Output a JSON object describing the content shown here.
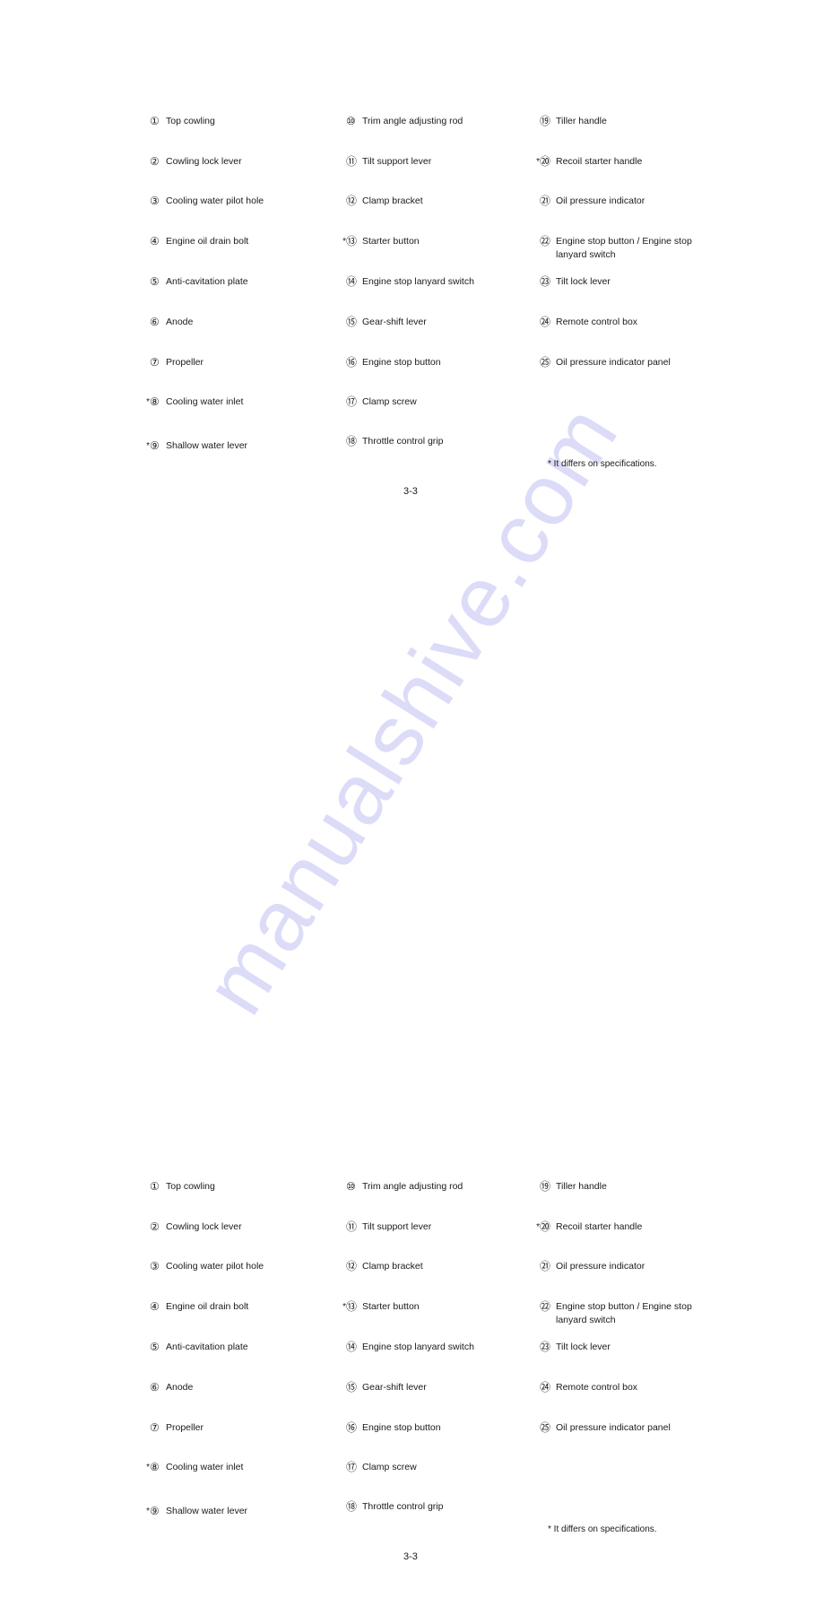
{
  "watermark": "manualshive.com",
  "pages": [
    {
      "columns": [
        [
          {
            "star": "",
            "num": "①",
            "label": "Top cowling"
          },
          {
            "star": "",
            "num": "②",
            "label": "Cowling lock lever"
          },
          {
            "star": "",
            "num": "③",
            "label": "Cooling water pilot hole"
          },
          {
            "star": "",
            "num": "④",
            "label": "Engine oil drain bolt"
          },
          {
            "star": "",
            "num": "⑤",
            "label": "Anti-cavitation plate"
          },
          {
            "star": "",
            "num": "⑥",
            "label": "Anode"
          },
          {
            "star": "",
            "num": "⑦",
            "label": "Propeller"
          },
          {
            "star": "*",
            "num": "⑧",
            "label": "Cooling water inlet"
          },
          {
            "star": "*",
            "num": "⑨",
            "label": "Shallow water lever"
          }
        ],
        [
          {
            "star": "",
            "num": "⑩",
            "label": "Trim angle adjusting rod"
          },
          {
            "star": "",
            "num": "⑪",
            "label": "Tilt support lever"
          },
          {
            "star": "",
            "num": "⑫",
            "label": "Clamp bracket"
          },
          {
            "star": "*",
            "num": "⑬",
            "label": "Starter button"
          },
          {
            "star": "",
            "num": "⑭",
            "label": "Engine stop lanyard switch"
          },
          {
            "star": "",
            "num": "⑮",
            "label": "Gear-shift lever"
          },
          {
            "star": "",
            "num": "⑯",
            "label": "Engine stop button"
          },
          {
            "star": "",
            "num": "⑰",
            "label": "Clamp screw"
          },
          {
            "star": "",
            "num": "⑱",
            "label": "Throttle control grip"
          }
        ],
        [
          {
            "star": "",
            "num": "⑲",
            "label": "Tiller handle"
          },
          {
            "star": "*",
            "num": "⑳",
            "label": "Recoil starter handle"
          },
          {
            "star": "",
            "num": "㉑",
            "label": "Oil pressure indicator"
          },
          {
            "star": "",
            "num": "㉒",
            "label": "Engine stop button / Engine stop",
            "label2": "lanyard switch"
          },
          {
            "star": "",
            "num": "㉓",
            "label": "Tilt lock lever"
          },
          {
            "star": "",
            "num": "㉔",
            "label": "Remote control box"
          },
          {
            "star": "",
            "num": "㉕",
            "label": "Oil pressure indicator panel"
          }
        ]
      ],
      "footnote": "* It differs on specifications.",
      "page_number": "3-3"
    },
    {
      "columns": [
        [
          {
            "star": "",
            "num": "①",
            "label": "Top cowling"
          },
          {
            "star": "",
            "num": "②",
            "label": "Cowling lock lever"
          },
          {
            "star": "",
            "num": "③",
            "label": "Cooling water pilot hole"
          },
          {
            "star": "",
            "num": "④",
            "label": "Engine oil drain bolt"
          },
          {
            "star": "",
            "num": "⑤",
            "label": "Anti-cavitation plate"
          },
          {
            "star": "",
            "num": "⑥",
            "label": "Anode"
          },
          {
            "star": "",
            "num": "⑦",
            "label": "Propeller"
          },
          {
            "star": "*",
            "num": "⑧",
            "label": "Cooling water inlet"
          },
          {
            "star": "*",
            "num": "⑨",
            "label": "Shallow water lever"
          }
        ],
        [
          {
            "star": "",
            "num": "⑩",
            "label": "Trim angle adjusting rod"
          },
          {
            "star": "",
            "num": "⑪",
            "label": "Tilt support lever"
          },
          {
            "star": "",
            "num": "⑫",
            "label": "Clamp bracket"
          },
          {
            "star": "*",
            "num": "⑬",
            "label": "Starter button"
          },
          {
            "star": "",
            "num": "⑭",
            "label": "Engine stop lanyard switch"
          },
          {
            "star": "",
            "num": "⑮",
            "label": "Gear-shift lever"
          },
          {
            "star": "",
            "num": "⑯",
            "label": "Engine stop button"
          },
          {
            "star": "",
            "num": "⑰",
            "label": "Clamp screw"
          },
          {
            "star": "",
            "num": "⑱",
            "label": "Throttle control grip"
          }
        ],
        [
          {
            "star": "",
            "num": "⑲",
            "label": "Tiller handle"
          },
          {
            "star": "*",
            "num": "⑳",
            "label": "Recoil starter handle"
          },
          {
            "star": "",
            "num": "㉑",
            "label": "Oil pressure indicator"
          },
          {
            "star": "",
            "num": "㉒",
            "label": "Engine stop button / Engine stop",
            "label2": "lanyard switch"
          },
          {
            "star": "",
            "num": "㉓",
            "label": "Tilt lock lever"
          },
          {
            "star": "",
            "num": "㉔",
            "label": "Remote control box"
          },
          {
            "star": "",
            "num": "㉕",
            "label": "Oil pressure indicator panel"
          }
        ]
      ],
      "footnote": "* It differs on specifications.",
      "page_number": "3-3"
    }
  ]
}
